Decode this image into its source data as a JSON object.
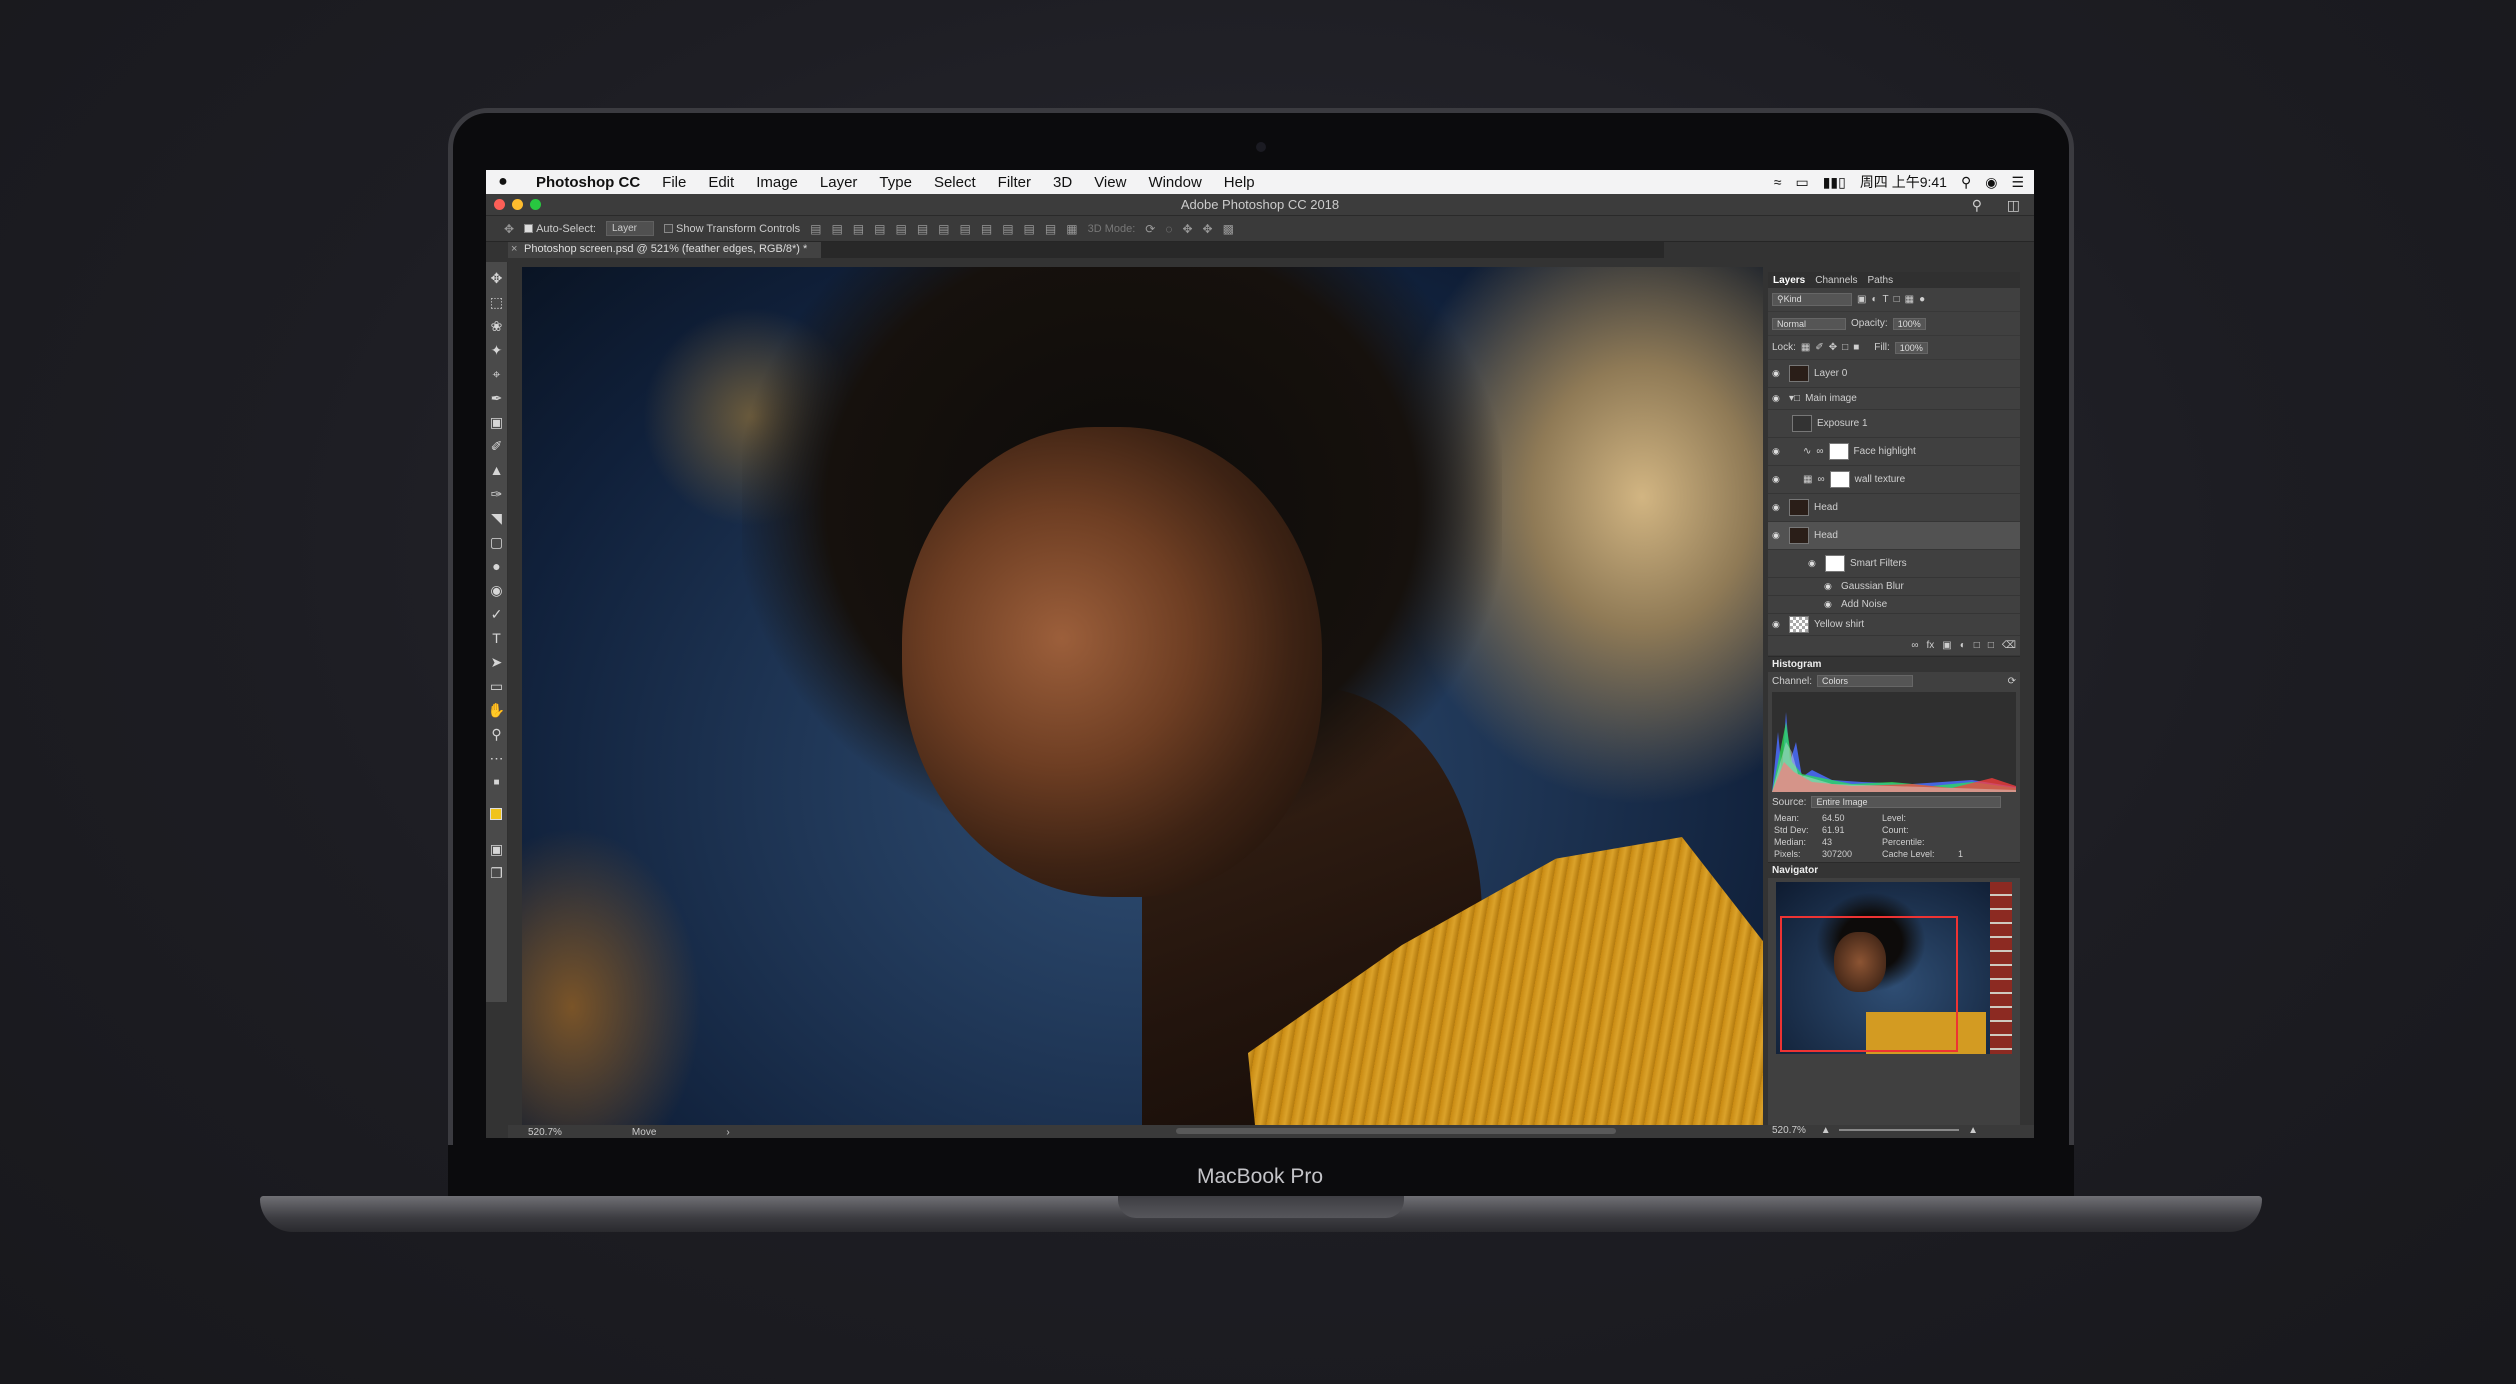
{
  "device": {
    "label": "MacBook Pro"
  },
  "menubar": {
    "apple": "",
    "app_name": "Photoshop CC",
    "items": [
      "File",
      "Edit",
      "Image",
      "Layer",
      "Type",
      "Select",
      "Filter",
      "3D",
      "View",
      "Window",
      "Help"
    ],
    "clock": "周四 上午9:41"
  },
  "window": {
    "title": "Adobe Photoshop CC 2018"
  },
  "options": {
    "auto_select_label": "Auto-Select:",
    "auto_select_value": "Layer",
    "transform_label": "Show Transform Controls",
    "mode_3d": "3D Mode:"
  },
  "document": {
    "tab": "Photoshop screen.psd @ 521% (feather edges, RGB/8*) *",
    "zoom": "520.7%",
    "tool_status": "Move"
  },
  "layers_panel": {
    "tabs": [
      "Layers",
      "Channels",
      "Paths"
    ],
    "filter": "Kind",
    "blend": "Normal",
    "opacity_label": "Opacity:",
    "opacity": "100%",
    "lock_label": "Lock:",
    "fill_label": "Fill:",
    "fill": "100%",
    "layers": [
      "Layer 0",
      "Main image",
      "Exposure 1",
      "Face highlight",
      "wall texture",
      "Head",
      "Head",
      "Smart Filters",
      "Gaussian Blur",
      "Add Noise",
      "Yellow shirt"
    ]
  },
  "histogram": {
    "title": "Histogram",
    "channel_label": "Channel:",
    "channel": "Colors",
    "source_label": "Source:",
    "source": "Entire Image",
    "stats": [
      {
        "label": "Mean:",
        "value": "64.50"
      },
      {
        "label": "Std Dev:",
        "value": "61.91"
      },
      {
        "label": "Median:",
        "value": "43"
      },
      {
        "label": "Pixels:",
        "value": "307200"
      }
    ],
    "stats_right": [
      "Level:",
      "Count:",
      "Percentile:",
      "Cache Level:"
    ],
    "cache_level": "1"
  },
  "navigator": {
    "title": "Navigator",
    "zoom": "520.7%"
  },
  "colors": {
    "foreground": "#f0c31c",
    "background": "#ffffff",
    "menubar": "#f3f3f4"
  }
}
